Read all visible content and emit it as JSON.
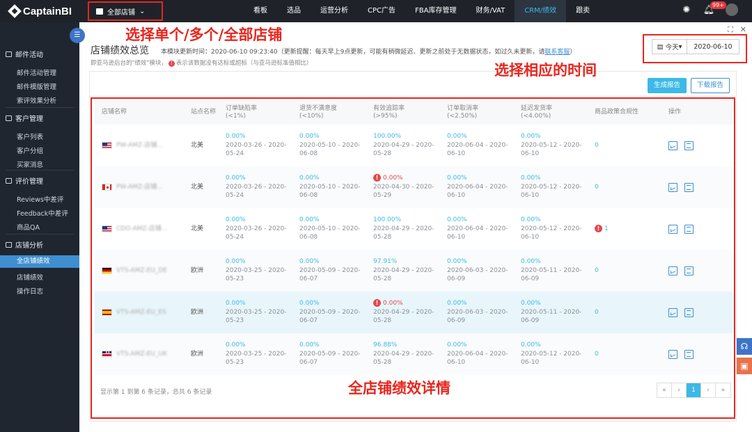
{
  "app": {
    "logo_text": "CaptainBI",
    "store_selector": "全部店铺"
  },
  "nav": [
    "看板",
    "选品",
    "运营分析",
    "CPC广告",
    "FBA库存管理",
    "财务/VAT",
    "CRM/绩效",
    "跟卖"
  ],
  "nav_active": "CRM/绩效",
  "notifications_badge": "99+",
  "sidebar": {
    "sections": [
      {
        "title": "邮件活动",
        "items": [
          "邮件活动管理",
          "邮件模版管理",
          "索评效果分析"
        ]
      },
      {
        "title": "客户管理",
        "items": [
          "客户列表",
          "客户分组",
          "买家消息"
        ]
      },
      {
        "title": "评价管理",
        "items": [
          "Reviews中差评",
          "Feedback中差评",
          "商品QA"
        ]
      },
      {
        "title": "店铺分析",
        "items": [
          "全店铺绩效",
          "店铺绩效",
          "操作日志"
        ]
      }
    ],
    "active_item": "全店铺绩效"
  },
  "page": {
    "title": "店铺绩效总览",
    "update_text": "本模块更新时间：2020-06-10 09:23:40（更新提醒：每天早上9点更新，可能有稍微延迟、更新之前处于无数据状态，如过久未更新，请",
    "contact_link": "联系客服",
    "update_tail": "）",
    "note_prefix": "即亚马逊后台的\"绩效\"模块，",
    "note_suffix": "表示该数据没有达标或超标（与亚马逊标准值相比）",
    "date_range": "今天",
    "date_value": "2020-06-10",
    "btn_generate": "生成报告",
    "btn_download": "下载报告"
  },
  "table": {
    "headers": [
      "店铺名称",
      "站点名称",
      "订单缺陷率\n(<1%)",
      "退货不满意度\n(<10%)",
      "有效追踪率\n(>95%)",
      "订单取消率\n(<2.50%)",
      "延迟发货率\n(<4.00%)",
      "商品政策合规性",
      "操作"
    ],
    "rows": [
      {
        "store": "PW-AMZ-店铺...",
        "flag": "us",
        "site": "北美",
        "odr": {
          "v": "0.00%",
          "d": "2020-03-26 - 2020-05-24"
        },
        "ret": {
          "v": "0.00%",
          "d": "2020-05-10 - 2020-06-08"
        },
        "vtr": {
          "v": "100.00%",
          "d": "2020-04-29 - 2020-05-28",
          "bad": false
        },
        "cancel": {
          "v": "0.00%",
          "d": "2020-06-04 - 2020-06-10"
        },
        "late": {
          "v": "0.00%",
          "d": "2020-05-12 - 2020-06-10"
        },
        "policy": "0",
        "policy_bad": false
      },
      {
        "store": "PW-AMZ-店铺...",
        "flag": "ca",
        "site": "北美",
        "odr": {
          "v": "0.00%",
          "d": "2020-03-26 - 2020-05-24"
        },
        "ret": {
          "v": "0.00%",
          "d": "2020-05-10 - 2020-06-08"
        },
        "vtr": {
          "v": "0.00%",
          "d": "2020-04-30 - 2020-05-29",
          "bad": true
        },
        "cancel": {
          "v": "0.00%",
          "d": "2020-06-04 - 2020-06-10"
        },
        "late": {
          "v": "0.00%",
          "d": "2020-05-12 - 2020-06-10"
        },
        "policy": "0",
        "policy_bad": false
      },
      {
        "store": "CDO-AMZ-店铺...",
        "flag": "us",
        "site": "北美",
        "odr": {
          "v": "0.00%",
          "d": "2020-03-26 - 2020-05-24"
        },
        "ret": {
          "v": "0.00%",
          "d": "2020-05-10 - 2020-06-08"
        },
        "vtr": {
          "v": "100.00%",
          "d": "2020-04-29 - 2020-05-28",
          "bad": false
        },
        "cancel": {
          "v": "0.00%",
          "d": "2020-06-04 - 2020-06-10"
        },
        "late": {
          "v": "0.00%",
          "d": "2020-05-12 - 2020-06-10"
        },
        "policy": "1",
        "policy_bad": true
      },
      {
        "store": "VTS-AMZ-EU_DE",
        "flag": "de",
        "site": "欧洲",
        "odr": {
          "v": "0.00%",
          "d": "2020-03-25 - 2020-05-23"
        },
        "ret": {
          "v": "0.00%",
          "d": "2020-05-09 - 2020-06-07"
        },
        "vtr": {
          "v": "97.91%",
          "d": "2020-04-29 - 2020-05-28",
          "bad": false
        },
        "cancel": {
          "v": "0.00%",
          "d": "2020-06-03 - 2020-06-09"
        },
        "late": {
          "v": "0.00%",
          "d": "2020-05-11 - 2020-06-09"
        },
        "policy": "0",
        "policy_bad": false
      },
      {
        "store": "VTS-AMZ-EU_ES",
        "flag": "es",
        "site": "欧洲",
        "odr": {
          "v": "0.00%",
          "d": "2020-03-25 - 2020-05-23"
        },
        "ret": {
          "v": "0.00%",
          "d": "2020-05-09 - 2020-06-07"
        },
        "vtr": {
          "v": "0.00%",
          "d": "2020-04-29 - 2020-05-28",
          "bad": true
        },
        "cancel": {
          "v": "0.00%",
          "d": "2020-06-03 - 2020-06-09"
        },
        "late": {
          "v": "0.00%",
          "d": "2020-05-11 - 2020-06-09"
        },
        "policy": "0",
        "policy_bad": false
      },
      {
        "store": "VTS-AMZ-EU_UK",
        "flag": "uk",
        "site": "欧洲",
        "odr": {
          "v": "0.00%",
          "d": "2020-03-25 - 2020-05-23"
        },
        "ret": {
          "v": "0.00%",
          "d": "2020-05-09 - 2020-06-07"
        },
        "vtr": {
          "v": "96.88%",
          "d": "2020-04-29 - 2020-05-28",
          "bad": false
        },
        "cancel": {
          "v": "0.00%",
          "d": "2020-06-04 - 2020-06-10"
        },
        "late": {
          "v": "0.00%",
          "d": "2020-05-12 - 2020-06-10"
        },
        "policy": "0",
        "policy_bad": false
      }
    ],
    "footer": "显示第 1 到第 6 条记录，总共 6 条记录",
    "pager": [
      "«",
      "‹",
      "1",
      "›",
      "»"
    ],
    "current_page": "1"
  },
  "annotations": {
    "select_store": "选择单个/多个/全部店铺",
    "select_time": "选择相应的时间",
    "detail": "全店铺绩效详情",
    "color": "#e8261e"
  },
  "colors": {
    "accent": "#3cb9e6",
    "primary": "#3e8ed0",
    "warn": "#e5484d",
    "topbar": "#1f2329",
    "sidebar": "#1f2630"
  }
}
